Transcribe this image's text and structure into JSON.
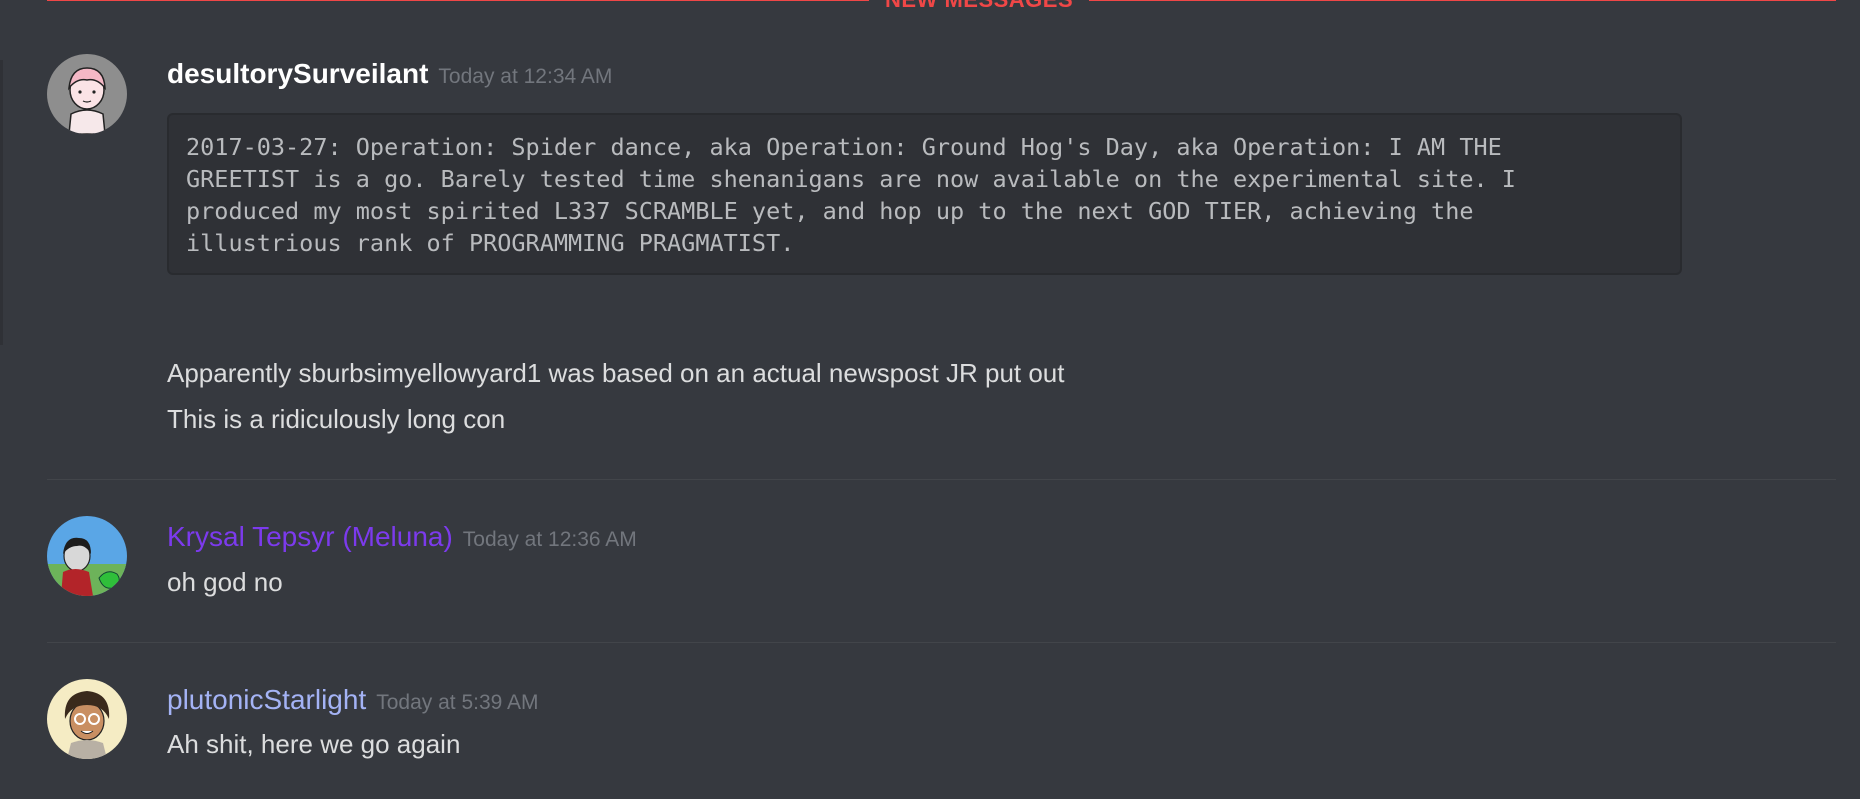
{
  "divider": {
    "label": "NEW MESSAGES"
  },
  "messages": [
    {
      "author": "desultorySurveilant",
      "timestamp": "Today at 12:34 AM",
      "code_lines": [
        "2017-03-27: Operation: Spider dance, aka Operation: Ground Hog's Day, aka Operation: I AM THE",
        "GREETIST is a go. Barely tested time shenanigans are now available on the experimental site. I",
        "produced my most spirited L337 SCRAMBLE yet, and hop up to the next GOD TIER, achieving the",
        "illustrious rank of PROGRAMMING PRAGMATIST."
      ],
      "lines": [
        "Apparently sburbsimyellowyard1 was based on an actual newspost JR put out",
        "This is a ridiculously long con"
      ]
    },
    {
      "author": "Krysal Tepsyr (Meluna)",
      "timestamp": "Today at 12:36 AM",
      "lines": [
        "oh god no"
      ]
    },
    {
      "author": "plutonicStarlight",
      "timestamp": "Today at 5:39 AM",
      "lines": [
        "Ah shit, here we go again"
      ]
    }
  ],
  "colors": {
    "background": "#36393f",
    "new_messages": "#f04747",
    "krysal_name": "#7c3aed",
    "plutonic_name": "#a4b3f5"
  },
  "icons": [
    "avatar-desultory",
    "avatar-krysal",
    "avatar-plutonic"
  ]
}
